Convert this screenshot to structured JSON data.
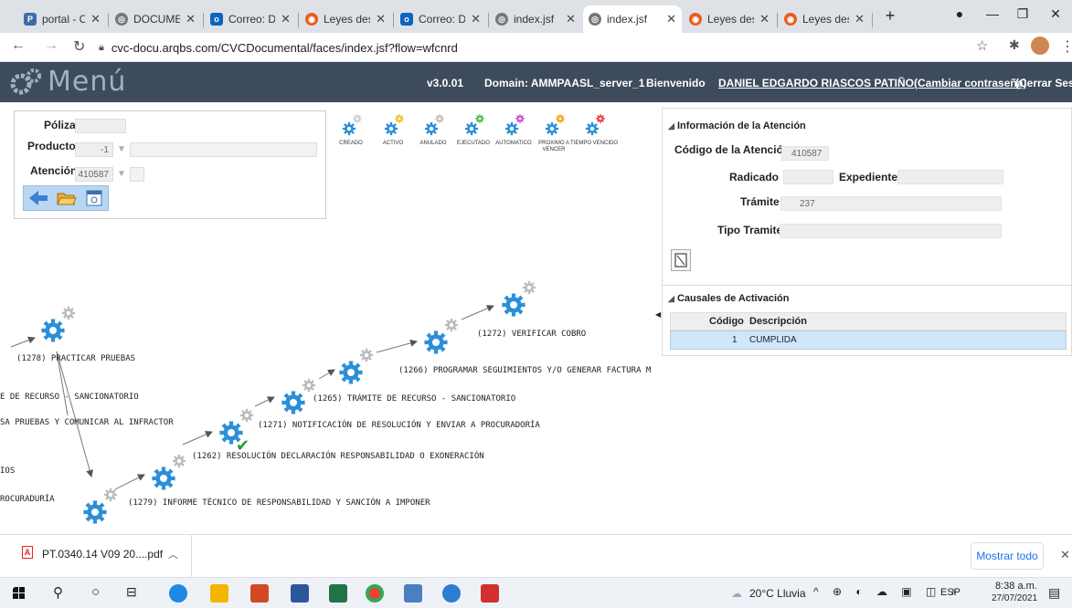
{
  "browser": {
    "tabs": [
      {
        "title": "portal - Ca",
        "icon": "portal-icon"
      },
      {
        "title": "DOCUMEN",
        "icon": "globe-icon"
      },
      {
        "title": "Correo: DA",
        "icon": "outlook-icon"
      },
      {
        "title": "Leyes desc",
        "icon": "leyes-icon"
      },
      {
        "title": "Correo: Da",
        "icon": "outlook-icon"
      },
      {
        "title": "index.jsf",
        "icon": "globe-icon"
      },
      {
        "title": "index.jsf",
        "icon": "globe-icon"
      },
      {
        "title": "Leyes desc",
        "icon": "leyes-icon"
      },
      {
        "title": "Leyes desc",
        "icon": "leyes-icon"
      }
    ],
    "new_tab": "+",
    "url": "cvc-docu.arqbs.com/CVCDocumental/faces/index.jsf?flow=wfcnrd"
  },
  "header": {
    "logo_text": "Menú",
    "version": "v3.0.01",
    "domain": "Domain: AMMPAASL_server_1",
    "welcome": "Bienvenido",
    "user": "DANIEL EDGARDO RIASCOS PATIÑO(Cambiar contraseña)",
    "logout": "(Cerrar Sesión"
  },
  "form": {
    "poliza_label": "Póliza",
    "producto_label": "Producto",
    "producto_value": "-1",
    "atencion_label": "Atención",
    "atencion_value": "410587"
  },
  "legend": [
    {
      "label": "CREADO",
      "color": "#cccccc"
    },
    {
      "label": "ACTIVO",
      "color": "#f0c020"
    },
    {
      "label": "ANULADO",
      "color": "#bbbbbb"
    },
    {
      "label": "EJECUTADO",
      "color": "#44bb44"
    },
    {
      "label": "AUTOMATICO",
      "color": "#cc44cc"
    },
    {
      "label": "PROXIMO A VENCER",
      "color": "#ff9900"
    },
    {
      "label": "TIEMPO VENCIDO",
      "color": "#ee3333"
    }
  ],
  "info": {
    "section_title": "Información de la Atención",
    "codigo_label": "Código de la Atención",
    "codigo_value": "410587",
    "radicado_label": "Radicado",
    "expediente_label": "Expediente",
    "tramite_label": "Trámite",
    "tramite_value": "237",
    "tipo_label": "Tipo Tramite"
  },
  "causales": {
    "section_title": "Causales de Activación",
    "columns": [
      "Código",
      "Descripción"
    ],
    "rows": [
      {
        "codigo": "1",
        "descripcion": "CUMPLIDA"
      }
    ]
  },
  "flow_nodes": [
    {
      "label": "(1278) PRACTICAR PRUEBAS"
    },
    {
      "label": "E DE RECURSO - SANCIONATORIO"
    },
    {
      "label": "SA PRUEBAS Y COMUNICAR AL INFRACTOR"
    },
    {
      "label": "IOS"
    },
    {
      "label": "ROCURADURÍA"
    },
    {
      "label": "(1279) INFORME TÉCNICO DE RESPONSABILIDAD Y SANCIÓN A IMPONER"
    },
    {
      "label": "(1262) RESOLUCIÓN DECLARACIÓN RESPONSABILIDAD O EXONERACIÓN"
    },
    {
      "label": "(1271) NOTIFICACIÓN DE RESOLUCIÓN Y ENVIAR A PROCURADORÍA"
    },
    {
      "label": "(1265) TRÁMITE DE RECURSO - SANCIONATORIO"
    },
    {
      "label": "(1266) PROGRAMAR SEGUIMIENTOS Y/O GENERAR FACTURA M"
    },
    {
      "label": "(1272) VERIFICAR COBRO"
    }
  ],
  "downloads": {
    "file": "PT.0340.14 V09 20....pdf",
    "show_all": "Mostrar todo"
  },
  "taskbar": {
    "weather": "20°C Lluvia",
    "lang": "ESP",
    "time": "8:38 a.m.",
    "date": "27/07/2021"
  }
}
